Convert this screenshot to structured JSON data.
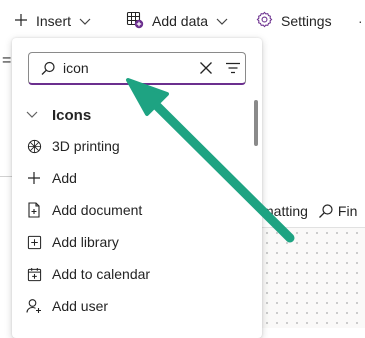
{
  "toolbar": {
    "insert_label": "Insert",
    "add_data_label": "Add data",
    "settings_label": "Settings",
    "more_glyph": "·"
  },
  "search": {
    "value": "icon"
  },
  "section": {
    "title": "Icons"
  },
  "items": [
    {
      "label": "3D printing",
      "icon": "3d-printing-icon"
    },
    {
      "label": "Add",
      "icon": "add-icon"
    },
    {
      "label": "Add document",
      "icon": "add-document-icon"
    },
    {
      "label": "Add library",
      "icon": "add-library-icon"
    },
    {
      "label": "Add to calendar",
      "icon": "add-to-calendar-icon"
    },
    {
      "label": "Add user",
      "icon": "add-user-icon"
    }
  ],
  "background": {
    "eq_glyph": "=",
    "formatting_label": "matting",
    "find_label": "Fin"
  },
  "colors": {
    "accent": "#6b2f8e",
    "arrow": "#1ea382"
  }
}
